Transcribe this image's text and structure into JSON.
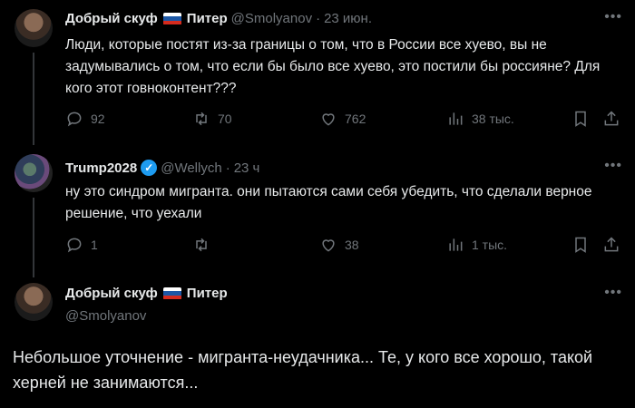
{
  "tweets": [
    {
      "name": "Добрый скуф",
      "name2": "Питер",
      "handle": "@Smolyanov",
      "sep": "·",
      "time": "23 июн.",
      "text": "Люди, которые постят из-за границы о том, что в России все хуево, вы не задумывались о том, что если бы было все хуево, это постили бы россияне? Для кого этот говноконтент???",
      "replies": "92",
      "retweets": "70",
      "likes": "762",
      "views": "38 тыс."
    },
    {
      "name": "Trump2028",
      "handle": "@Wellych",
      "sep": "·",
      "time": "23 ч",
      "text": "ну это синдром мигранта. они пытаются сами себя убедить, что сделали верное решение, что уехали",
      "replies": "1",
      "retweets": "",
      "likes": "38",
      "views": "1 тыс."
    },
    {
      "name": "Добрый скуф",
      "name2": "Питер",
      "handle": "@Smolyanov",
      "text": "Небольшое уточнение - мигранта-неудачника... Те, у кого все хорошо, такой херней не занимаются..."
    }
  ],
  "colors": {
    "bg": "#000000",
    "text": "#e7e9ea",
    "muted": "#71767b",
    "verified": "#1d9bf0"
  },
  "icons": [
    "reply-icon",
    "retweet-icon",
    "like-icon",
    "views-icon",
    "bookmark-icon",
    "share-icon",
    "more-icon",
    "ru-flag-icon",
    "verified-badge-icon"
  ]
}
